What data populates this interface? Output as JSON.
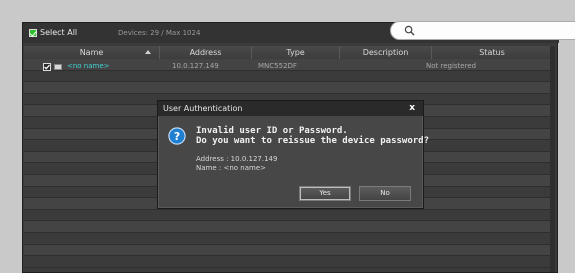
{
  "topbar": {
    "select_all": "Select All",
    "device_count": "Devices: 29 / Max 1024",
    "search_value": ""
  },
  "table": {
    "columns": [
      "Name",
      "Address",
      "Type",
      "Description",
      "Status"
    ],
    "rows": [
      {
        "name": "<no name>",
        "address": "10.0.127.149",
        "type": "MNC552DF",
        "description": "",
        "status": "Not registered"
      }
    ]
  },
  "dialog": {
    "title": "User Authentication",
    "close": "x",
    "message_line1": "Invalid user ID or Password.",
    "message_line2": "Do you want to reissue the device password?",
    "address_line": "Address : 10.0.127.149",
    "name_line": "Name : <no name>",
    "yes_label": "Yes",
    "no_label": "No"
  },
  "colors": {
    "accent_checkbox": "#2bbf2b",
    "device_name": "#3fd3d3",
    "question_icon": "#1f7fd0"
  },
  "icons": [
    "checkbox-icon",
    "search-icon",
    "sort-ascending-icon",
    "device-icon",
    "question-icon",
    "close-icon"
  ]
}
